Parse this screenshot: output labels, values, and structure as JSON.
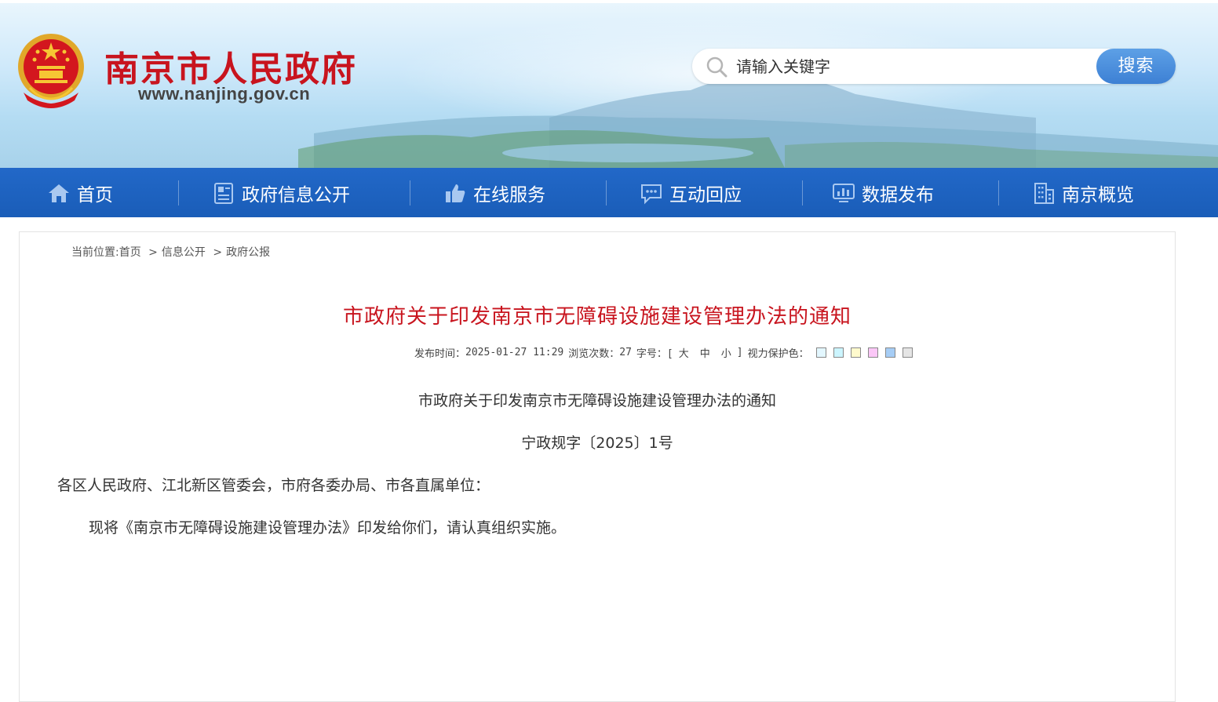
{
  "header": {
    "site_title": "南京市人民政府",
    "site_url": "www.nanjing.gov.cn",
    "search": {
      "placeholder": "请输入关键字",
      "button_label": "搜索"
    }
  },
  "nav": {
    "items": [
      {
        "label": "首页",
        "icon": "home-icon"
      },
      {
        "label": "政府信息公开",
        "icon": "document-icon"
      },
      {
        "label": "在线服务",
        "icon": "thumbs-up-icon"
      },
      {
        "label": "互动回应",
        "icon": "chat-icon"
      },
      {
        "label": "数据发布",
        "icon": "chart-monitor-icon"
      },
      {
        "label": "南京概览",
        "icon": "building-icon"
      }
    ]
  },
  "breadcrumb": {
    "prefix": "当前位置:",
    "items": [
      "首页",
      "信息公开",
      "政府公报"
    ],
    "separator": ">"
  },
  "article": {
    "title": "市政府关于印发南京市无障碍设施建设管理办法的通知",
    "meta": {
      "publish_label": "发布时间：",
      "publish_time": "2025-01-27 11:29",
      "views_label": "浏览次数：",
      "views": "27",
      "font_label": "字号：[",
      "font_large": "大",
      "font_medium": "中",
      "font_small": "小",
      "font_end": "]",
      "eye_label": "视力保护色："
    },
    "eye_colors": [
      "#e3f7ff",
      "#ccf5ff",
      "#fffacd",
      "#fbc7f7",
      "#a6cdf5",
      "#e5e5e5"
    ],
    "doc_heading": "市政府关于印发南京市无障碍设施建设管理办法的通知",
    "doc_number": "宁政规字〔2025〕1号",
    "addressee": "各区人民政府、江北新区管委会，市府各委办局、市各直属单位：",
    "body": "现将《南京市无障碍设施建设管理办法》印发给你们，请认真组织实施。"
  },
  "colors": {
    "brand_red": "#c8141e",
    "nav_blue": "#1a5db8",
    "search_button_blue": "#4a8ddc"
  }
}
